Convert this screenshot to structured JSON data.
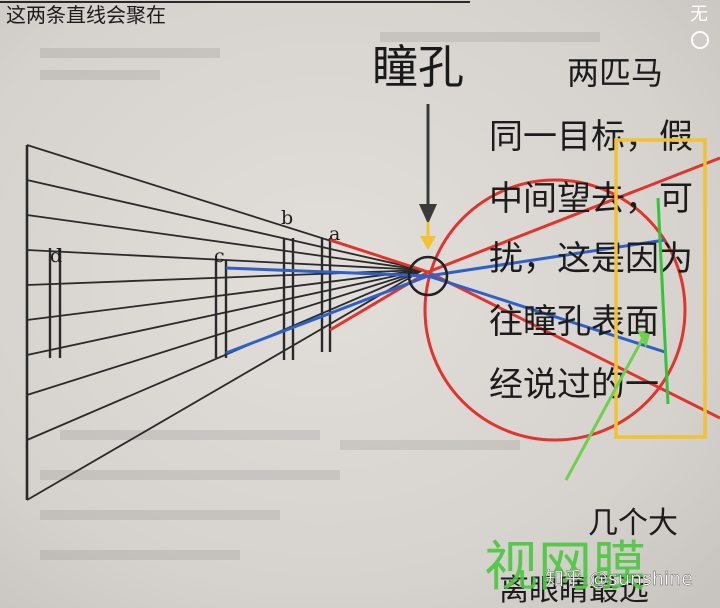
{
  "annotations": {
    "pupil_label": "瞳孔",
    "retina_label": "视网膜"
  },
  "diagram_labels": {
    "a": "a",
    "b": "b",
    "c": "c",
    "d": "d"
  },
  "page_text": {
    "top_line": "这两条直线会聚在",
    "lines": [
      "两匹马",
      "同一目标，假",
      "中间望去，可",
      "扰，这是因为",
      "往瞳孔表面",
      "经说过的一",
      "几个大",
      "离眼睛最远"
    ]
  },
  "watermark": {
    "text": "知乎 @sunshine",
    "side_text": "无"
  },
  "colors": {
    "paper": "#d8d4cf",
    "ink": "#1c1c1c",
    "red": "#e0342c",
    "blue": "#2f5fc9",
    "yellow": "#f2c230",
    "green": "#33c43a",
    "arrow": "#3a3a3a"
  }
}
